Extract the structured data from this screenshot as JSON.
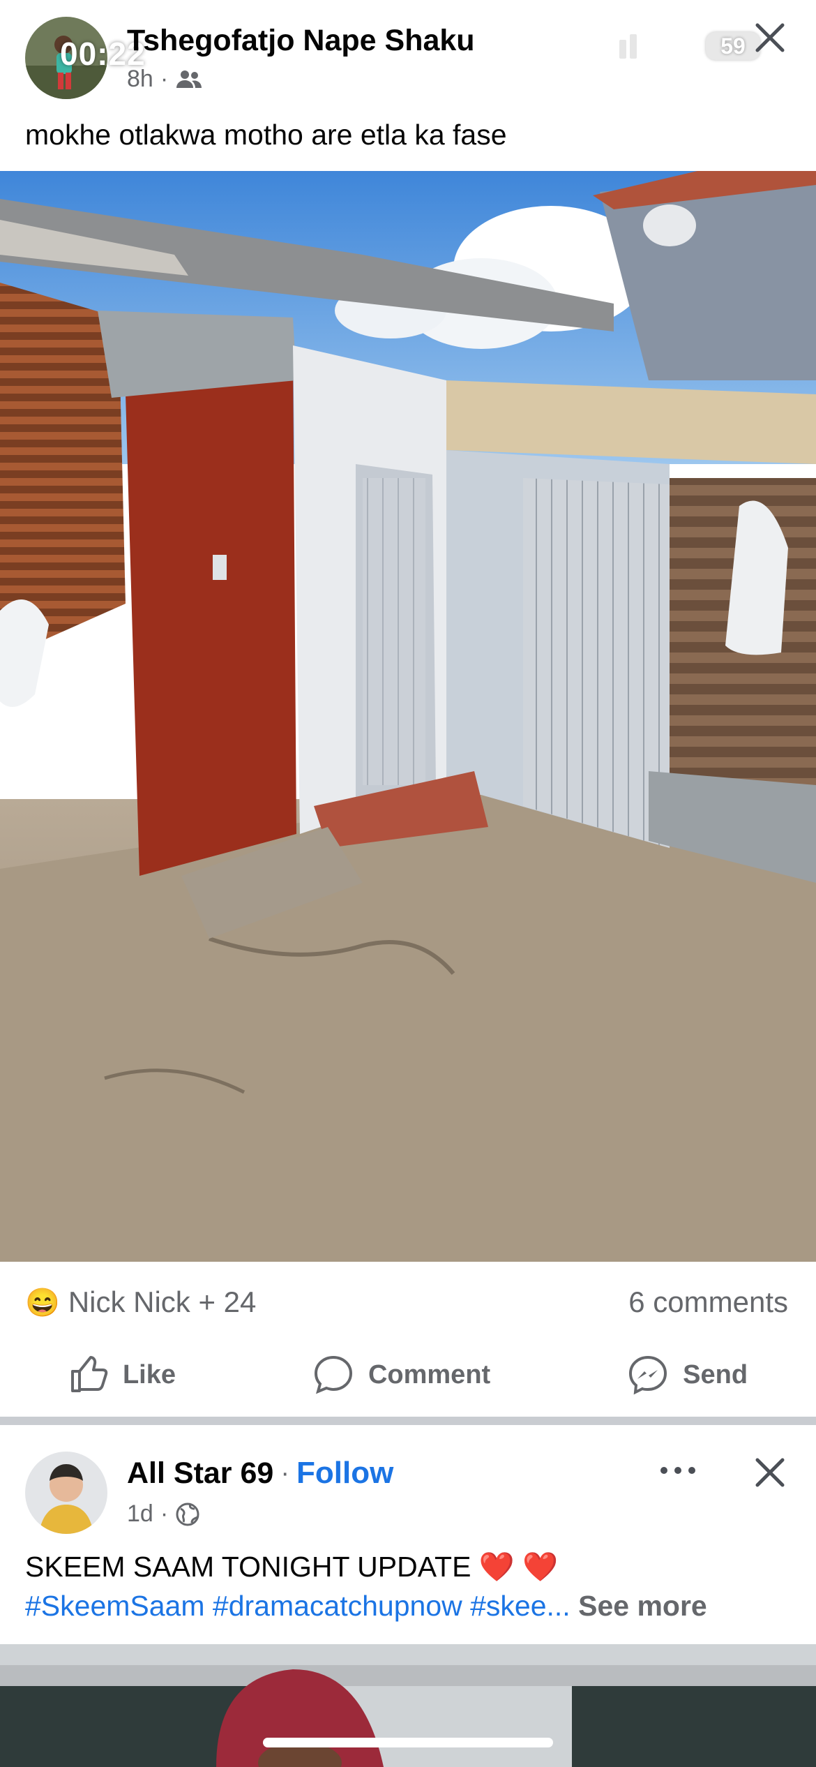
{
  "status_bar": {
    "time": "00:22",
    "battery": "59"
  },
  "post1": {
    "author": "Tshegofatjo Nape Shaku",
    "time": "8h",
    "separator": "·",
    "text": "mokhe otlakwa motho are etla ka fase",
    "reactions": {
      "emoji": "😄",
      "label": "Nick Nick + 24"
    },
    "comments": "6 comments",
    "actions": {
      "like": "Like",
      "comment": "Comment",
      "send": "Send"
    }
  },
  "post2": {
    "author": "All Star 69",
    "separator": "·",
    "follow": "Follow",
    "time": "1d",
    "text": "SKEEM SAAM TONIGHT UPDATE",
    "hearts": "❤️ ❤️",
    "hashtags": "#SkeemSaam #dramacatchupnow #skee...",
    "see_more": "See more"
  },
  "icons": [
    "close-icon",
    "friends-icon",
    "globe-icon",
    "more-icon",
    "like-icon",
    "comment-icon",
    "messenger-icon",
    "signal-icon",
    "wifi-icon",
    "battery-icon"
  ],
  "colors": {
    "link_blue": "#1b74e4",
    "secondary_text": "#65676b",
    "divider": "#c9ccd1"
  }
}
